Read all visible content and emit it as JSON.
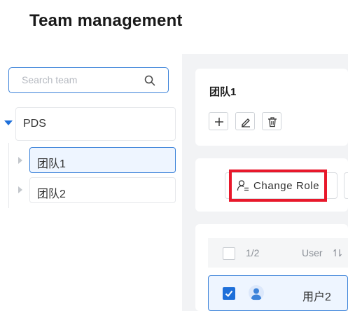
{
  "page": {
    "title": "Team management"
  },
  "search": {
    "placeholder": "Search team"
  },
  "tree": {
    "root": "PDS",
    "children": [
      {
        "label": "团队1",
        "selected": true
      },
      {
        "label": "团队2",
        "selected": false
      }
    ]
  },
  "team": {
    "name": "团队1"
  },
  "toolbar": {
    "change_role_label": "Change Role"
  },
  "table": {
    "count": "1/2",
    "user_col": "User",
    "rows": [
      {
        "name": "用户2",
        "checked": true
      }
    ]
  },
  "colors": {
    "accent": "#1e6fd9",
    "highlight": "#e8182b",
    "pane_bg": "#f2f3f5"
  }
}
